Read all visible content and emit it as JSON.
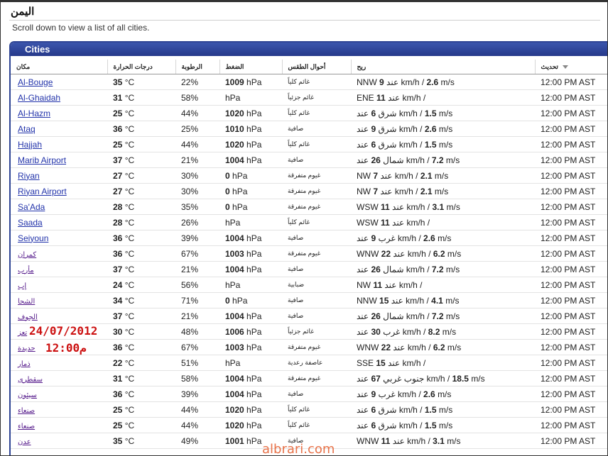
{
  "page": {
    "title": "اليمن",
    "instruction": "Scroll down to view a list of all cities."
  },
  "panel": {
    "title": "Cities"
  },
  "columns": {
    "city": "مكان",
    "temp": "درجات الحرارة",
    "humidity": "الرطوبة",
    "pressure": "الضغط",
    "conditions": "أحوال الطقس",
    "wind": "ريح",
    "updated": "تحديث"
  },
  "rows": [
    {
      "city": "Al-Bouge",
      "temp": "35",
      "temp_unit": "°C",
      "hum": "22%",
      "press": "1009",
      "press_unit": "hPa",
      "cond": "غائم كلياً",
      "wind_dir": "NNW",
      "wind_kmh": "9",
      "wind_ms": "2.6"
    },
    {
      "city": "Al-Ghaidah",
      "temp": "31",
      "temp_unit": "°C",
      "hum": "58%",
      "press": "",
      "press_unit": "hPa",
      "cond": "غائم جزئياً",
      "wind_dir": "ENE",
      "wind_kmh": "11",
      "wind_ms": ""
    },
    {
      "city": "Al-Hazm",
      "temp": "25",
      "temp_unit": "°C",
      "hum": "44%",
      "press": "1020",
      "press_unit": "hPa",
      "cond": "غائم كلياً",
      "wind_dir": "شرق",
      "wind_kmh": "6",
      "wind_ms": "1.5"
    },
    {
      "city": "Ataq",
      "temp": "36",
      "temp_unit": "°C",
      "hum": "25%",
      "press": "1010",
      "press_unit": "hPa",
      "cond": "صافية",
      "wind_dir": "شرق",
      "wind_kmh": "9",
      "wind_ms": "2.6"
    },
    {
      "city": "Hajjah",
      "temp": "25",
      "temp_unit": "°C",
      "hum": "44%",
      "press": "1020",
      "press_unit": "hPa",
      "cond": "غائم كلياً",
      "wind_dir": "شرق",
      "wind_kmh": "6",
      "wind_ms": "1.5"
    },
    {
      "city": "Marib Airport",
      "temp": "37",
      "temp_unit": "°C",
      "hum": "21%",
      "press": "1004",
      "press_unit": "hPa",
      "cond": "صافية",
      "wind_dir": "شمال",
      "wind_kmh": "26",
      "wind_ms": "7.2"
    },
    {
      "city": "Riyan",
      "temp": "27",
      "temp_unit": "°C",
      "hum": "30%",
      "press": "0",
      "press_unit": "hPa",
      "cond": "غيوم متفرقة",
      "wind_dir": "NW",
      "wind_kmh": "7",
      "wind_ms": "2.1"
    },
    {
      "city": "Riyan Airport",
      "temp": "27",
      "temp_unit": "°C",
      "hum": "30%",
      "press": "0",
      "press_unit": "hPa",
      "cond": "غيوم متفرقة",
      "wind_dir": "NW",
      "wind_kmh": "7",
      "wind_ms": "2.1"
    },
    {
      "city": "Sa'Ada",
      "temp": "28",
      "temp_unit": "°C",
      "hum": "35%",
      "press": "0",
      "press_unit": "hPa",
      "cond": "غيوم متفرقة",
      "wind_dir": "WSW",
      "wind_kmh": "11",
      "wind_ms": "3.1"
    },
    {
      "city": "Saada",
      "temp": "28",
      "temp_unit": "°C",
      "hum": "26%",
      "press": "",
      "press_unit": "hPa",
      "cond": "غائم كلياً",
      "wind_dir": "WSW",
      "wind_kmh": "11",
      "wind_ms": ""
    },
    {
      "city": "Seiyoun",
      "temp": "36",
      "temp_unit": "°C",
      "hum": "39%",
      "press": "1004",
      "press_unit": "hPa",
      "cond": "صافية",
      "wind_dir": "غرب",
      "wind_kmh": "9",
      "wind_ms": "2.6"
    },
    {
      "city": "كمران",
      "temp": "36",
      "temp_unit": "°C",
      "hum": "67%",
      "press": "1003",
      "press_unit": "hPa",
      "cond": "غيوم متفرقة",
      "wind_dir": "WNW",
      "wind_kmh": "22",
      "wind_ms": "6.2"
    },
    {
      "city": "مأرب",
      "temp": "37",
      "temp_unit": "°C",
      "hum": "21%",
      "press": "1004",
      "press_unit": "hPa",
      "cond": "صافية",
      "wind_dir": "شمال",
      "wind_kmh": "26",
      "wind_ms": "7.2"
    },
    {
      "city": "إب",
      "temp": "24",
      "temp_unit": "°C",
      "hum": "56%",
      "press": "",
      "press_unit": "hPa",
      "cond": "ضبابية",
      "wind_dir": "NW",
      "wind_kmh": "11",
      "wind_ms": ""
    },
    {
      "city": "الشحا",
      "temp": "34",
      "temp_unit": "°C",
      "hum": "71%",
      "press": "0",
      "press_unit": "hPa",
      "cond": "صافية",
      "wind_dir": "NNW",
      "wind_kmh": "15",
      "wind_ms": "4.1"
    },
    {
      "city": "الجوف",
      "temp": "37",
      "temp_unit": "°C",
      "hum": "21%",
      "press": "1004",
      "press_unit": "hPa",
      "cond": "صافية",
      "wind_dir": "شمال",
      "wind_kmh": "26",
      "wind_ms": "7.2"
    },
    {
      "city": "تعز",
      "temp": "30",
      "temp_unit": "°C",
      "hum": "48%",
      "press": "1006",
      "press_unit": "hPa",
      "cond": "غائم جزئياً",
      "wind_dir": "غرب",
      "wind_kmh": "30",
      "wind_ms": "8.2"
    },
    {
      "city": "حديدة",
      "temp": "36",
      "temp_unit": "°C",
      "hum": "67%",
      "press": "1003",
      "press_unit": "hPa",
      "cond": "غيوم متفرقة",
      "wind_dir": "WNW",
      "wind_kmh": "22",
      "wind_ms": "6.2"
    },
    {
      "city": "ذمار",
      "temp": "22",
      "temp_unit": "°C",
      "hum": "51%",
      "press": "",
      "press_unit": "hPa",
      "cond": "عاصفة رعدية",
      "wind_dir": "SSE",
      "wind_kmh": "15",
      "wind_ms": ""
    },
    {
      "city": "سقطرى",
      "temp": "31",
      "temp_unit": "°C",
      "hum": "58%",
      "press": "1004",
      "press_unit": "hPa",
      "cond": "غيوم متفرقة",
      "wind_dir": "جنوب غربي",
      "wind_kmh": "67",
      "wind_ms": "18.5"
    },
    {
      "city": "سيئون",
      "temp": "36",
      "temp_unit": "°C",
      "hum": "39%",
      "press": "1004",
      "press_unit": "hPa",
      "cond": "صافية",
      "wind_dir": "غرب",
      "wind_kmh": "9",
      "wind_ms": "2.6"
    },
    {
      "city": "صنعاء",
      "temp": "25",
      "temp_unit": "°C",
      "hum": "44%",
      "press": "1020",
      "press_unit": "hPa",
      "cond": "غائم كلياً",
      "wind_dir": "شرق",
      "wind_kmh": "6",
      "wind_ms": "1.5"
    },
    {
      "city": "صنعاء",
      "temp": "25",
      "temp_unit": "°C",
      "hum": "44%",
      "press": "1020",
      "press_unit": "hPa",
      "cond": "غائم كلياً",
      "wind_dir": "شرق",
      "wind_kmh": "6",
      "wind_ms": "1.5"
    },
    {
      "city": "عدن",
      "temp": "35",
      "temp_unit": "°C",
      "hum": "49%",
      "press": "1001",
      "press_unit": "hPa",
      "cond": "صافية",
      "wind_dir": "WNW",
      "wind_kmh": "11",
      "wind_ms": "3.1"
    }
  ],
  "labels": {
    "at": "عند",
    "kmh": "km/h /",
    "ms": "m/s",
    "updated": "12:00 PM AST"
  },
  "overlay": {
    "date": "24/07/2012",
    "time": "12:00م",
    "watermark": "albrari.com"
  }
}
